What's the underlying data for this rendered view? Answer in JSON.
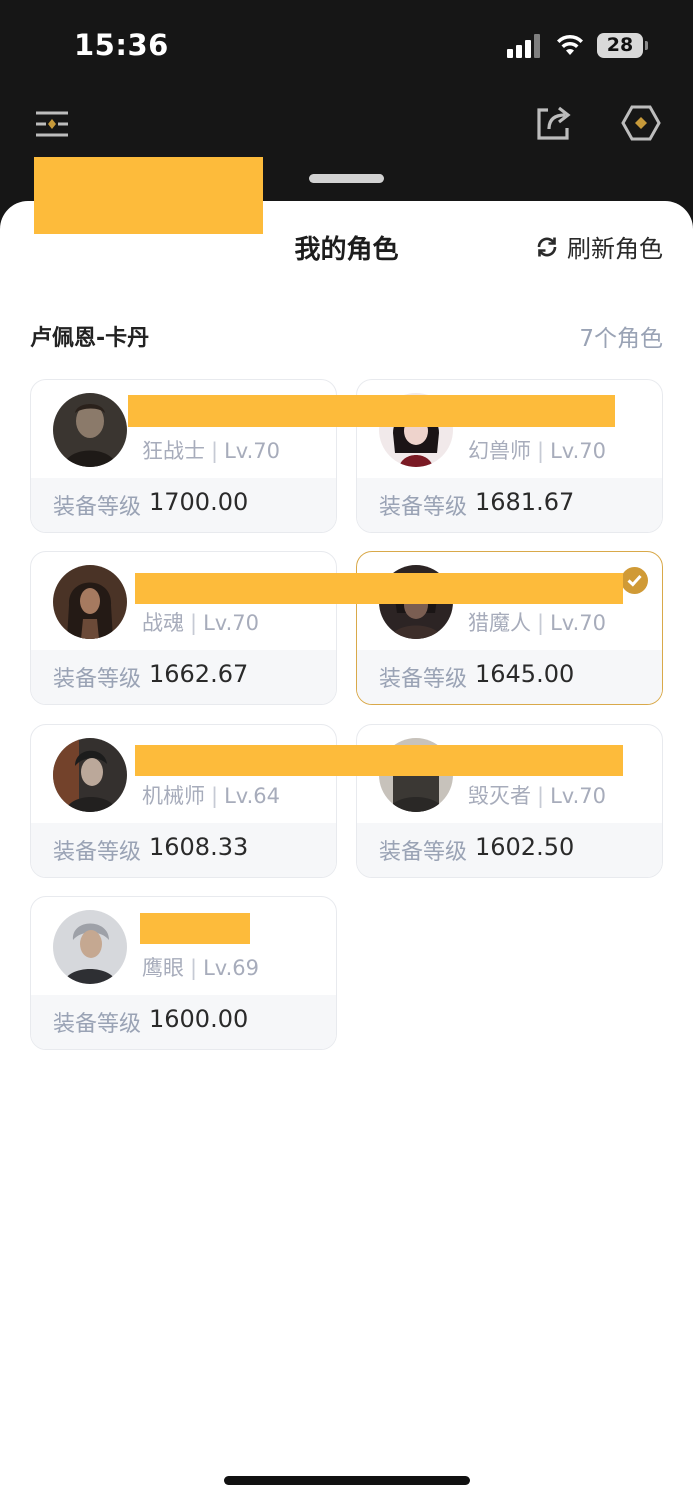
{
  "status_bar": {
    "time": "15:36",
    "battery": "28"
  },
  "app_bar": {
    "menu_icon": "sliders-icon",
    "share_icon": "share-icon",
    "settings_icon": "hexagon-settings-icon"
  },
  "sheet": {
    "title": "我的角色",
    "refresh_label": "刷新角色",
    "server_name": "卢佩恩-卡丹",
    "role_count": "7个角色",
    "gear_label": "装备等级",
    "characters": [
      {
        "class": "狂战士",
        "level": "Lv.70",
        "gear": "1700.00",
        "selected": false,
        "avatar_color": "#3a3530"
      },
      {
        "class": "幻兽师",
        "level": "Lv.70",
        "gear": "1681.67",
        "selected": false,
        "avatar_color": "#2a1c1e"
      },
      {
        "class": "战魂",
        "level": "Lv.70",
        "gear": "1662.67",
        "selected": false,
        "avatar_color": "#4a3326"
      },
      {
        "class": "猎魔人",
        "level": "Lv.70",
        "gear": "1645.00",
        "selected": true,
        "avatar_color": "#2c2424"
      },
      {
        "class": "机械师",
        "level": "Lv.64",
        "gear": "1608.33",
        "selected": false,
        "avatar_color": "#34302e"
      },
      {
        "class": "毁灭者",
        "level": "Lv.70",
        "gear": "1602.50",
        "selected": false,
        "avatar_color": "#3b3834"
      },
      {
        "class": "鹰眼",
        "level": "Lv.69",
        "gear": "1600.00",
        "selected": false,
        "avatar_color": "#5c5f66"
      }
    ]
  },
  "colors": {
    "redaction": "#fdbb3b",
    "accent": "#d09a36"
  }
}
